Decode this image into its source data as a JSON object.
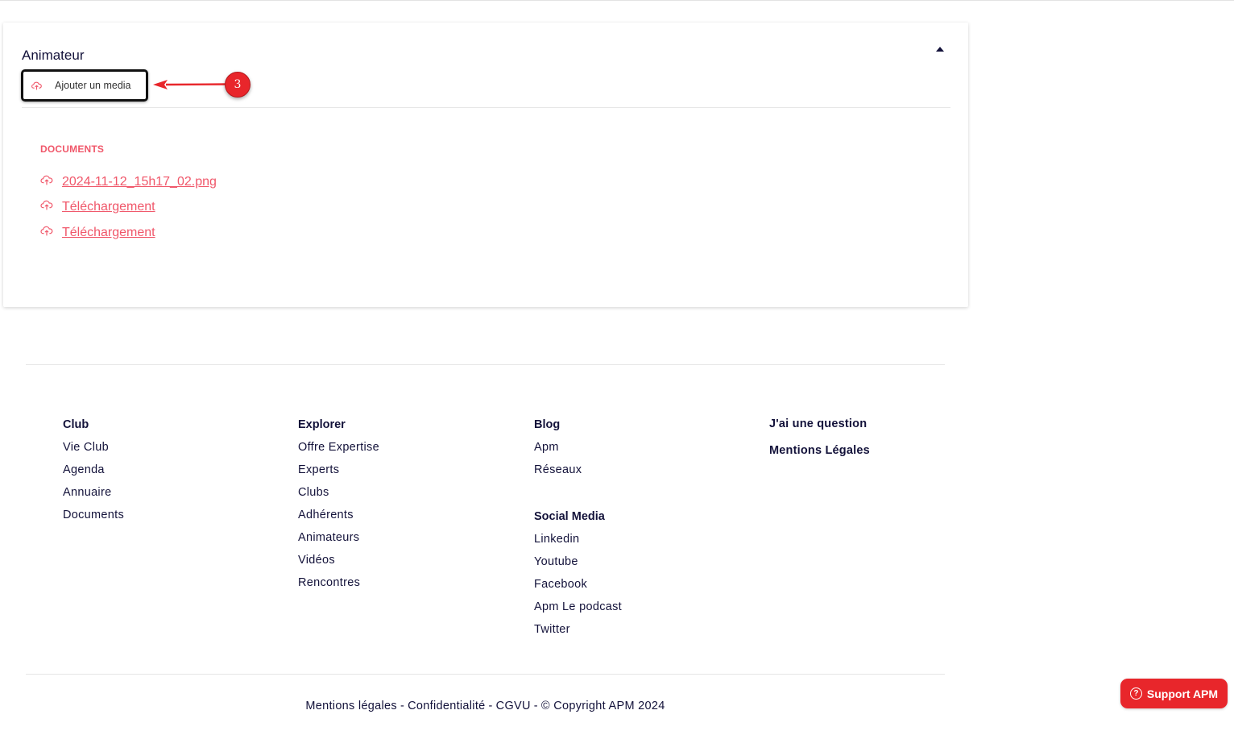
{
  "card": {
    "title": "Animateur",
    "add_media_label": "Ajouter un media",
    "documents_heading": "DOCUMENTS",
    "documents": [
      "2024-11-12_15h17_02.png",
      "Téléchargement",
      "Téléchargement"
    ]
  },
  "annotation": {
    "step_number": "3"
  },
  "footer": {
    "club": {
      "heading": "Club",
      "links": [
        "Vie Club",
        "Agenda",
        "Annuaire",
        "Documents"
      ]
    },
    "explorer": {
      "heading": "Explorer",
      "links": [
        "Offre Expertise",
        "Experts",
        "Clubs",
        "Adhérents",
        "Animateurs",
        "Vidéos",
        "Rencontres"
      ]
    },
    "blog": {
      "heading": "Blog",
      "links": [
        "Apm",
        "Réseaux"
      ]
    },
    "social": {
      "heading": "Social Media",
      "links": [
        "Linkedin",
        "Youtube",
        "Facebook",
        "Apm Le podcast",
        "Twitter"
      ]
    },
    "question_label": "J'ai une question",
    "mentions_label": "Mentions Légales",
    "bottom": {
      "mentions": "Mentions légales",
      "confidentiality": "Confidentialité",
      "cgvu": "CGVU",
      "copyright": "© Copyright APM 2024",
      "separator": "-"
    }
  },
  "support": {
    "label": "Support APM",
    "icon_glyph": "?"
  },
  "colors": {
    "accent": "#f0576a",
    "annotation_red": "#e8262b",
    "text_dark": "#13123a"
  }
}
